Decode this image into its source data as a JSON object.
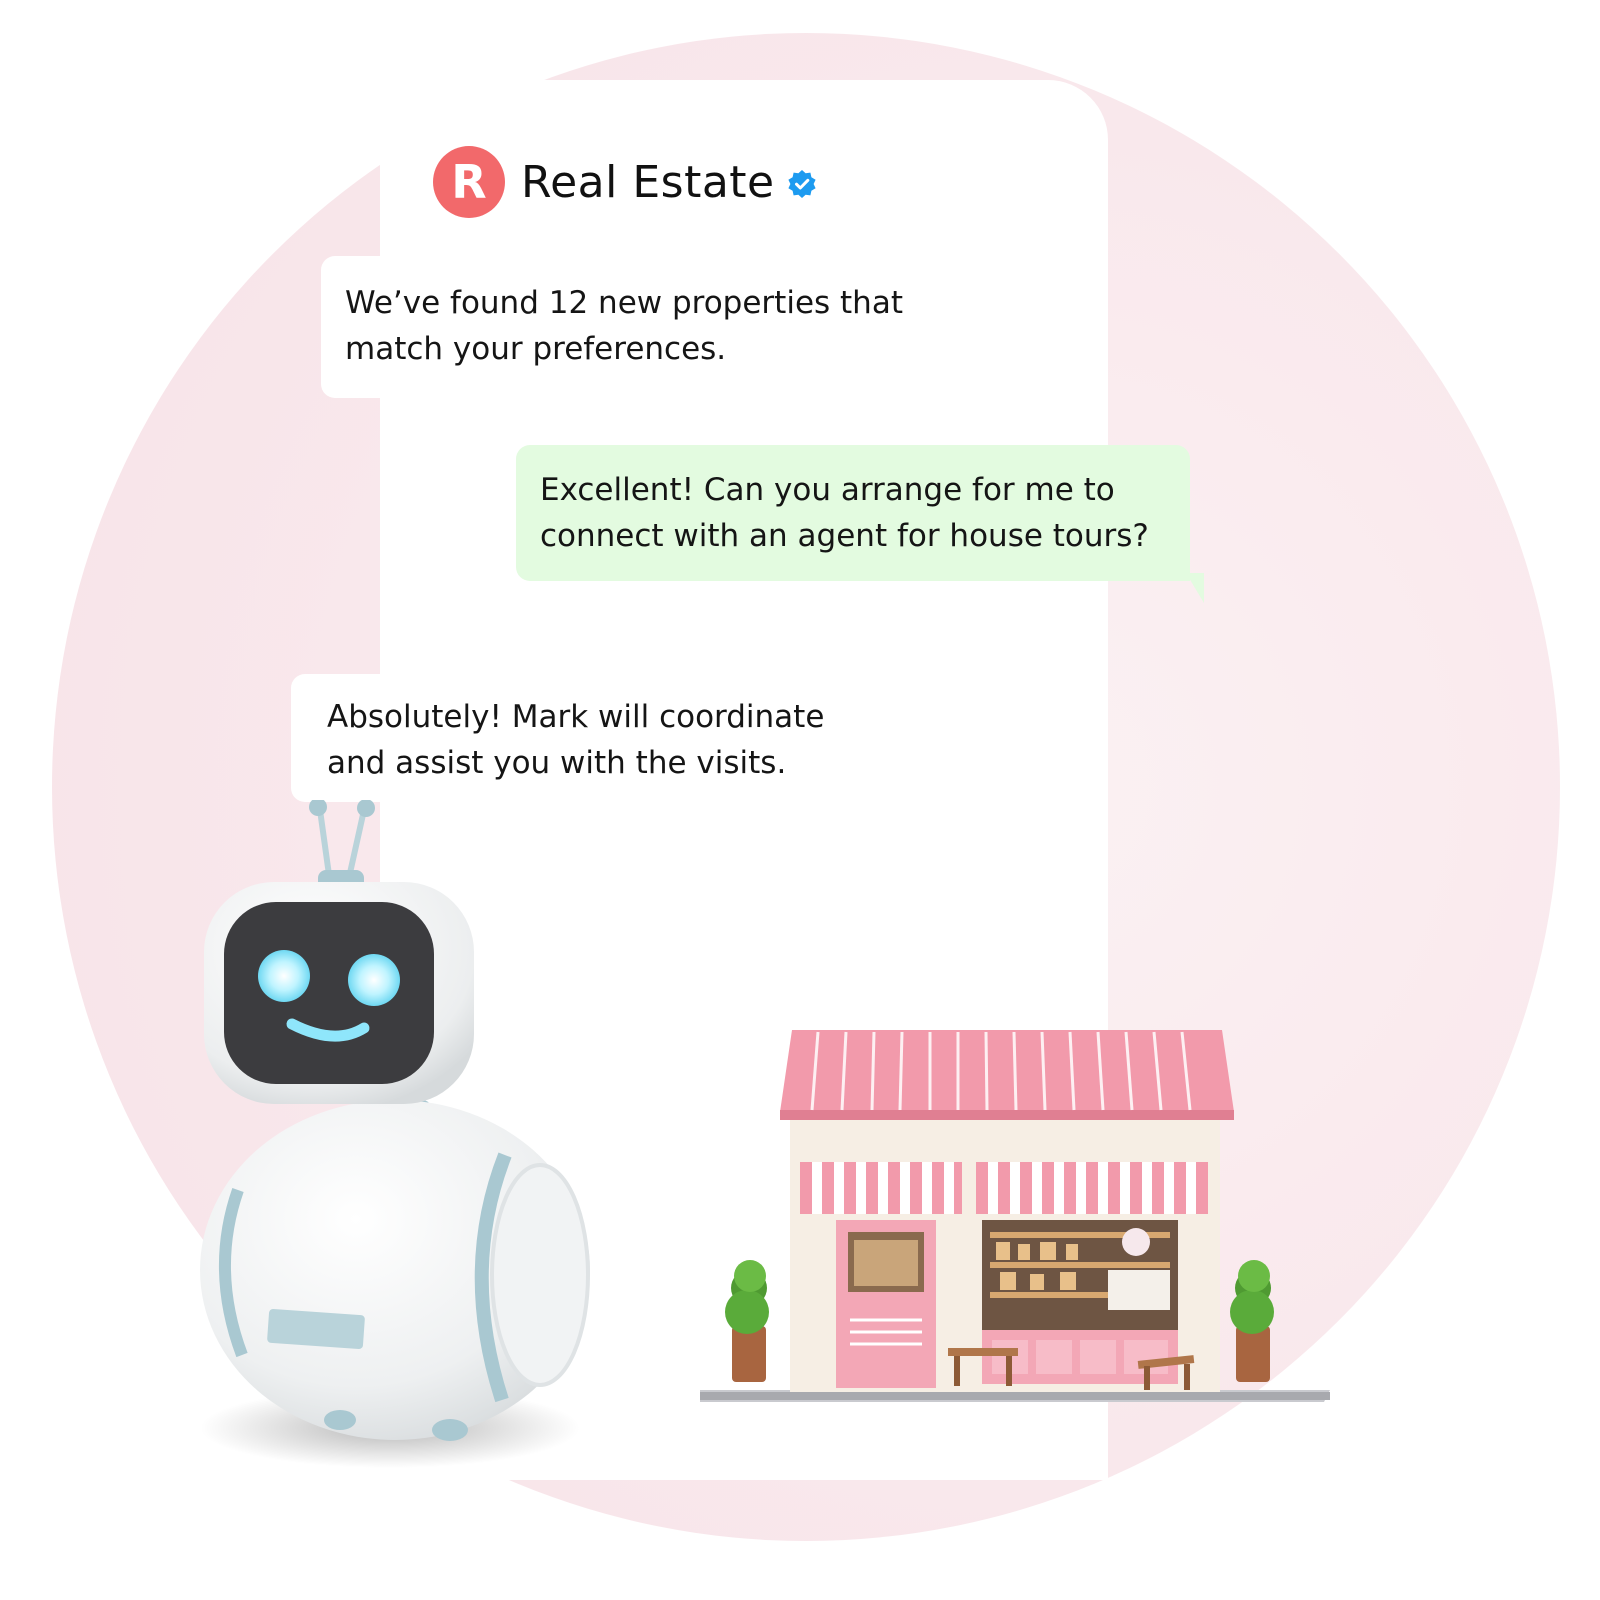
{
  "header": {
    "logo_letter": "R",
    "brand_name": "Real Estate",
    "verified_icon": "verified-badge-icon",
    "logo_color": "#f2696b",
    "verified_color": "#1d9bf0"
  },
  "messages": [
    {
      "sender": "bot",
      "lines": [
        "We’ve found 12 new properties that",
        "match your preferences."
      ]
    },
    {
      "sender": "user",
      "lines": [
        "Excellent! Can you arrange for me to",
        "connect with an agent for house tours?"
      ]
    },
    {
      "sender": "bot",
      "lines": [
        "Absolutely! Mark will coordinate",
        "and assist you with the visits."
      ]
    }
  ],
  "illustrations": {
    "robot": "robot-mascot-illustration",
    "store": "pink-storefront-illustration"
  },
  "colors": {
    "background_circle": "#f8e6ea",
    "outgoing_bubble": "#e3fbe0",
    "incoming_bubble": "#ffffff"
  }
}
